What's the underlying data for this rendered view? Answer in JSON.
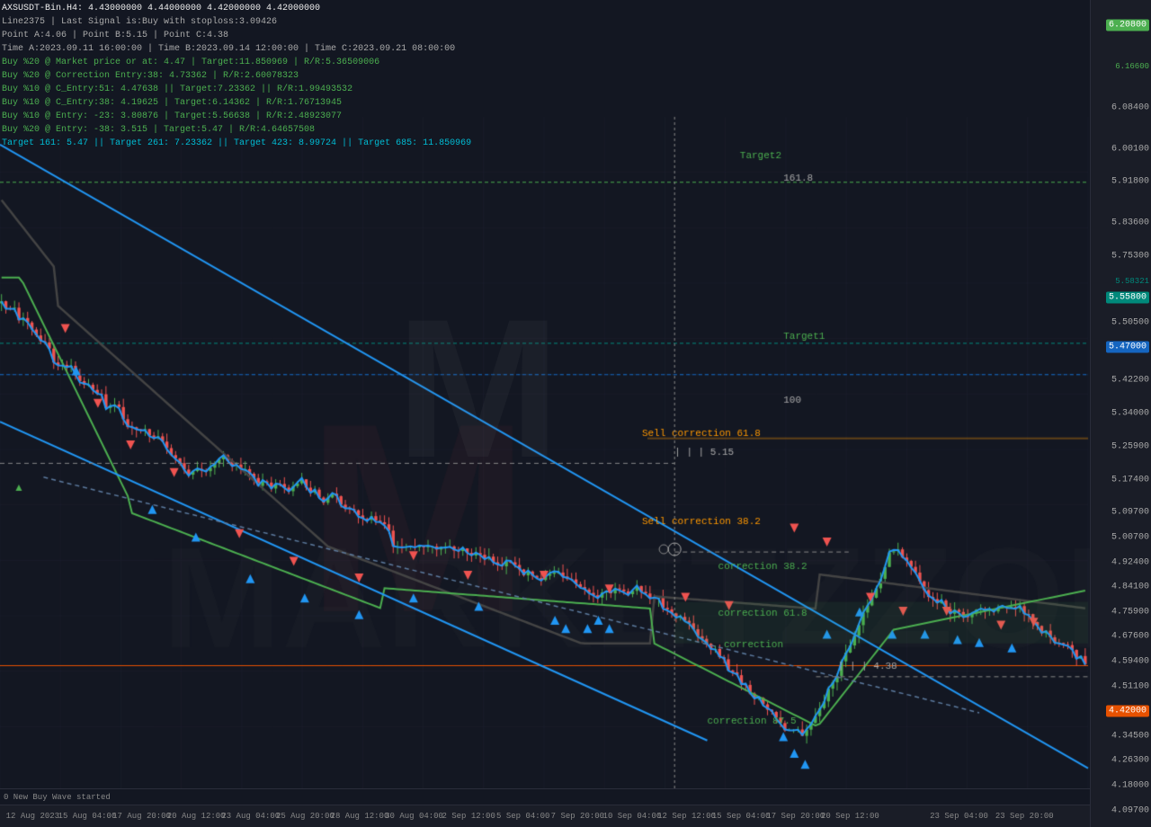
{
  "chart": {
    "symbol": "AXSUSDT-Bin.H4",
    "ohlc": "4.43000000 4.44000000 4.42000000 4.42000000",
    "signal_info": "Last Signal is:Buy with stoploss:3.09426",
    "line": "Line:2375",
    "point_a": "Point A:4.06",
    "point_b": "Point B:5.15",
    "point_c": "Point C:4.38",
    "info_lines": [
      "AXSUSDT-Bin.H4: 4.43000000  4.44000000  4.42000000  4.42000000",
      "Line2375 | Last Signal is:Buy with stoploss:3.09426",
      "Point A:4.06 | Point B:5.15 | Point C:4.38",
      "Time A:2023.09.11 16:00:00 | Time B:2023.09.14 12:00:00 | Time C:2023.09.21 08:00:00",
      "Buy %20 @ Market price or at: 4.47 | Target:11.850969 | R/R:5.36509006",
      "Buy %20 @ Correction Entry:38: 4.73362 | R/R:2.60078323",
      "Buy %10 @ C_Entry:51: 4.47638 || Target:7.23362 || R/R:1.99493532",
      "Buy %10 @ C_Entry:38: 4.19625 | Target:6.14362 | R/R:1.76713945",
      "Buy %10 @ Entry: -23: 3.80876 | Target:5.56638 | R/R:2.48923077",
      "Buy %20 @ Entry: -38: 3.515 | Target:5.47 | R/R:4.64657508",
      "Target 161: 5.47 || Target 261: 7.23362 || Target 423: 8.99724 || Target 685: 11.850969"
    ],
    "price_levels": {
      "target2": {
        "price": 6.2,
        "label": "Target2",
        "color": "#4caf50"
      },
      "p161": {
        "price": 6.1636,
        "label": "161.8",
        "color": "#aaa"
      },
      "level_6208": {
        "price": 6.208,
        "label": "6.20800",
        "color": "#4caf50"
      },
      "level_5836": {
        "price": 5.836,
        "label": "5.58321",
        "color": "#00897b"
      },
      "target1": {
        "price": 5.58,
        "label": "Target1",
        "color": "#4caf50"
      },
      "level_547": {
        "price": 5.47,
        "label": "5.47000",
        "color": "#1565c0"
      },
      "level_515": {
        "price": 5.15,
        "label": "5.15",
        "color": "#aaa"
      },
      "sell_corr618": {
        "price": 5.22,
        "label": "Sell correction 61.8",
        "color": "#ff9800"
      },
      "sell_corr382": {
        "price": 4.9,
        "label": "Sell correction 38.2",
        "color": "#ff9800"
      },
      "corr382": {
        "price": 4.75,
        "label": "correction 38.2",
        "color": "#4caf50"
      },
      "corr618": {
        "price": 4.58,
        "label": "correction 61.8",
        "color": "#4caf50"
      },
      "level_442": {
        "price": 4.42,
        "label": "4.42000",
        "color": "#e65100"
      },
      "level_438": {
        "price": 4.38,
        "label": "4.38",
        "color": "#aaa"
      },
      "corr875": {
        "price": 4.2,
        "label": "correction 87.5",
        "color": "#4caf50"
      },
      "level_p100": {
        "price": 5.35,
        "label": "100",
        "color": "#aaa"
      }
    },
    "time_labels": [
      "12 Aug 2023",
      "15 Aug 04:00",
      "17 Aug 20:00",
      "20 Aug 12:00",
      "23 Aug 04:00",
      "25 Aug 20:00",
      "28 Aug 12:00",
      "30 Aug 04:00",
      "2 Sep 12:00",
      "5 Sep 04:00",
      "7 Sep 20:00",
      "10 Sep 04:00",
      "12 Sep 12:00",
      "15 Sep 04:00",
      "17 Sep 20:00",
      "20 Sep 12:00",
      "23 Sep 04:00",
      "23 Sep 20:00"
    ],
    "bottom_bar": "0  New  Buy  Wave  started",
    "colors": {
      "bg": "#131722",
      "grid": "#1e2130",
      "up_candle": "#4caf50",
      "down_candle": "#ef5350",
      "ma_black": "#555",
      "ma_green": "#4caf50",
      "ma_blue": "#2196f3",
      "trendline_blue": "#2196f3",
      "trendline_dashed": "#5c7a9e"
    }
  }
}
